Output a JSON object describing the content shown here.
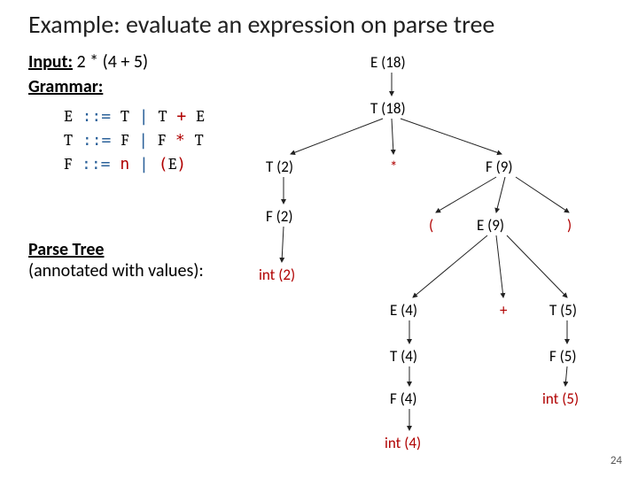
{
  "title": "Example: evaluate an expression on parse tree",
  "input": {
    "label": "Input:",
    "expr": " 2 * (4 + 5)"
  },
  "grammarLabel": "Grammar:",
  "grammar": {
    "r1a": "E",
    "r1b": " ::= ",
    "r1c": "T",
    "r1d": " | ",
    "r1e": "T",
    "r1f": " + ",
    "r1g": "E",
    "r2a": "T",
    "r2b": " ::= ",
    "r2c": "F",
    "r2d": " | ",
    "r2e": "F",
    "r2f": " * ",
    "r2g": "T",
    "r3a": "F",
    "r3b": " ::= ",
    "r3c": "n",
    "r3d": " | ",
    "r3e": "(",
    "r3f": "E",
    "r3g": ")"
  },
  "caption": {
    "l1": "Parse Tree",
    "l2": "(annotated with values):"
  },
  "pageNum": "24",
  "tree": {
    "E18": "E  (18)",
    "T18": "T  (18)",
    "T2": "T  (2)",
    "star": "*",
    "F9": "F  (9)",
    "F2": "F  (2)",
    "lpar": "(",
    "E9": "E (9)",
    "rpar": ")",
    "int2": "int (2)",
    "E4": "E  (4)",
    "plus": "+",
    "T5": "T  (5)",
    "T4": "T  (4)",
    "F5": "F  (5)",
    "F4": "F  (4)",
    "int5": "int (5)",
    "int4": "int (4)"
  }
}
